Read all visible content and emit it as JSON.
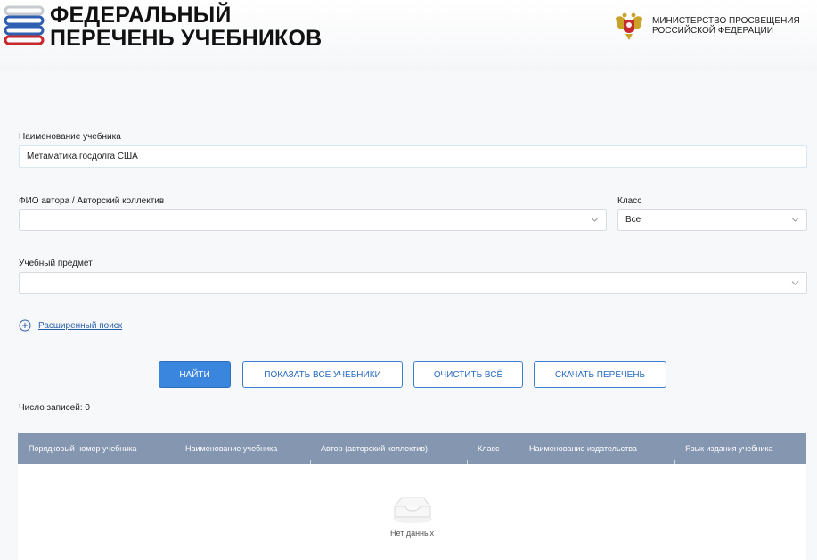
{
  "header": {
    "logo_icon": "stacked-books-icon",
    "title_line1": "ФЕДЕРАЛЬНЫЙ",
    "title_line2": "ПЕРЕЧЕНЬ УЧЕБНИКОВ",
    "ministry_emblem": "coat-of-arms-icon",
    "ministry_line1": "МИНИСТЕРСТВО ПРОСВЕЩЕНИЯ",
    "ministry_line2": "РОССИЙСКОЙ ФЕДЕРАЦИИ"
  },
  "form": {
    "textbook_name": {
      "label": "Наименование учебника",
      "value": "Метаматика госдолга США"
    },
    "author": {
      "label": "ФИО автора / Авторский коллектив",
      "value": ""
    },
    "grade": {
      "label": "Класс",
      "value": "Все"
    },
    "subject": {
      "label": "Учебный предмет",
      "value": ""
    },
    "advanced_search": "Расширенный поиск"
  },
  "buttons": {
    "find": "НАЙТИ",
    "show_all": "ПОКАЗАТЬ ВСЕ УЧЕБНИКИ",
    "clear_all": "ОЧИСТИТЬ ВСЁ",
    "download": "СКАЧАТЬ ПЕРЕЧЕНЬ"
  },
  "results": {
    "count_label": "Число записей: 0",
    "columns": [
      "Порядковый номер учебника",
      "Наименование учебника",
      "Автор (авторский коллектив)",
      "Класс",
      "Наименование издательства",
      "Язык издания учебника"
    ],
    "empty_text": "Нет данных"
  },
  "colors": {
    "accent": "#3a85de",
    "table_header": "#8496b0",
    "link": "#2a5fa8"
  }
}
